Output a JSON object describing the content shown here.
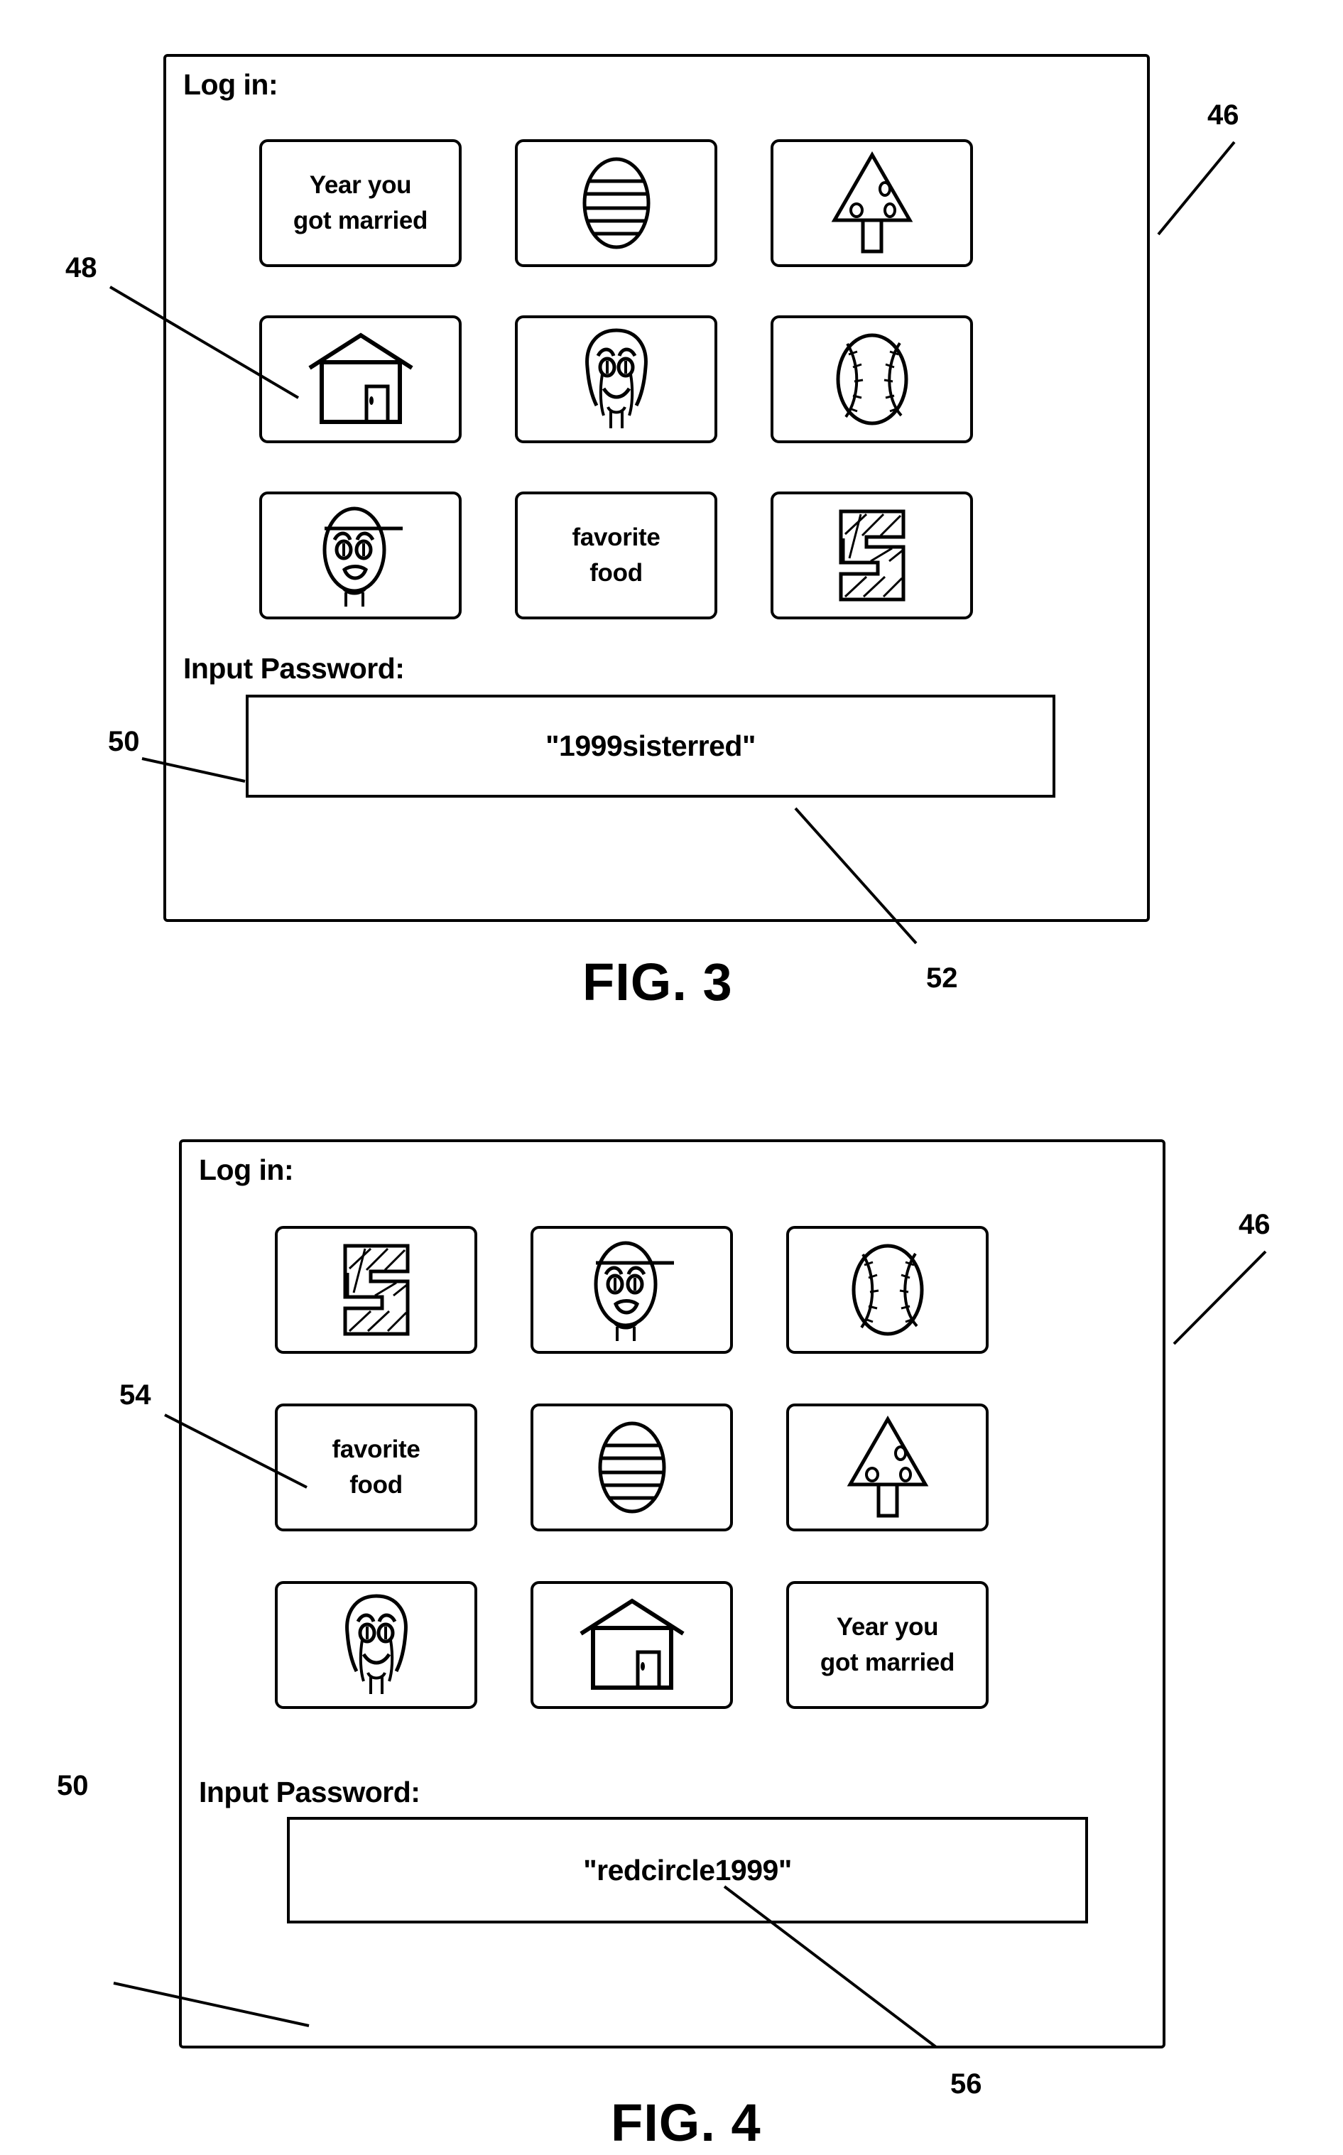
{
  "figures": [
    {
      "id": "fig3",
      "caption": "FIG. 3",
      "panel_title": "Log in:",
      "password_label": "Input Password:",
      "password_value": "\"1999sisterred\"",
      "tiles": [
        {
          "icon": "text",
          "label": "Year you\ngot married"
        },
        {
          "icon": "striped-circle-icon",
          "label": ""
        },
        {
          "icon": "tree-icon",
          "label": ""
        },
        {
          "icon": "house-icon",
          "label": ""
        },
        {
          "icon": "long-hair-face-icon",
          "label": ""
        },
        {
          "icon": "baseball-icon",
          "label": ""
        },
        {
          "icon": "hat-face-icon",
          "label": ""
        },
        {
          "icon": "text",
          "label": "favorite\nfood"
        },
        {
          "icon": "block-five-icon",
          "label": ""
        }
      ],
      "references": [
        {
          "num": "46",
          "target": "login-panel"
        },
        {
          "num": "48",
          "target": "house-tile"
        },
        {
          "num": "50",
          "target": "password-box"
        },
        {
          "num": "52",
          "target": "password-value"
        }
      ]
    },
    {
      "id": "fig4",
      "caption": "FIG. 4",
      "panel_title": "Log in:",
      "password_label": "Input Password:",
      "password_value": "\"redcircle1999\"",
      "tiles": [
        {
          "icon": "block-five-icon",
          "label": ""
        },
        {
          "icon": "hat-face-icon",
          "label": ""
        },
        {
          "icon": "baseball-icon",
          "label": ""
        },
        {
          "icon": "text",
          "label": "favorite\nfood"
        },
        {
          "icon": "striped-circle-icon",
          "label": ""
        },
        {
          "icon": "tree-icon",
          "label": ""
        },
        {
          "icon": "long-hair-face-icon",
          "label": ""
        },
        {
          "icon": "house-icon",
          "label": ""
        },
        {
          "icon": "text",
          "label": "Year you\ngot married"
        }
      ],
      "references": [
        {
          "num": "46",
          "target": "login-panel"
        },
        {
          "num": "54",
          "target": "favorite-food-tile"
        },
        {
          "num": "50",
          "target": "password-box"
        },
        {
          "num": "56",
          "target": "password-value"
        }
      ]
    }
  ],
  "colors": {
    "ink": "#000000",
    "paper": "#ffffff"
  }
}
